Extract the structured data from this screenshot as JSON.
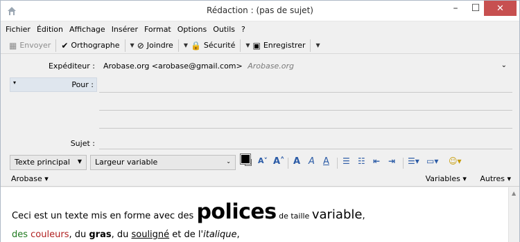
{
  "window": {
    "title": "Rédaction : (pas de sujet)",
    "minimize": "–",
    "maximize": "☐",
    "close": "✕"
  },
  "menubar": [
    {
      "label": "Fichier"
    },
    {
      "label": "Édition"
    },
    {
      "label": "Affichage"
    },
    {
      "label": "Insérer"
    },
    {
      "label": "Format"
    },
    {
      "label": "Options"
    },
    {
      "label": "Outils"
    },
    {
      "label": "?"
    }
  ],
  "toolbar": {
    "send": "Envoyer",
    "spell": "Orthographe",
    "attach": "Joindre",
    "security": "Sécurité",
    "save": "Enregistrer"
  },
  "headers": {
    "from_label": "Expéditeur :",
    "from_value": "Arobase.org <arobase@gmail.com>",
    "from_alias": "Arobase.org",
    "to_label": "Pour :",
    "subject_label": "Sujet :"
  },
  "format": {
    "paragraph_style": "Texte principal",
    "font_family": "Largeur variable"
  },
  "bar": {
    "arobase": "Arobase",
    "variables": "Variables",
    "autres": "Autres"
  },
  "body": {
    "l1_a": "Ceci est un texte mis en forme avec des ",
    "l1_police": "polices",
    "l1_b": " de taille ",
    "l1_var": "variable",
    "l1_c": ",",
    "l2_a": "des ",
    "l2_couleurs": "couleurs",
    "l2_b": ", du ",
    "l2_gras": "gras",
    "l2_c": ", du ",
    "l2_souligne": "souligné",
    "l2_d": " et de l'",
    "l2_italique": "italique",
    "l2_e": ","
  }
}
